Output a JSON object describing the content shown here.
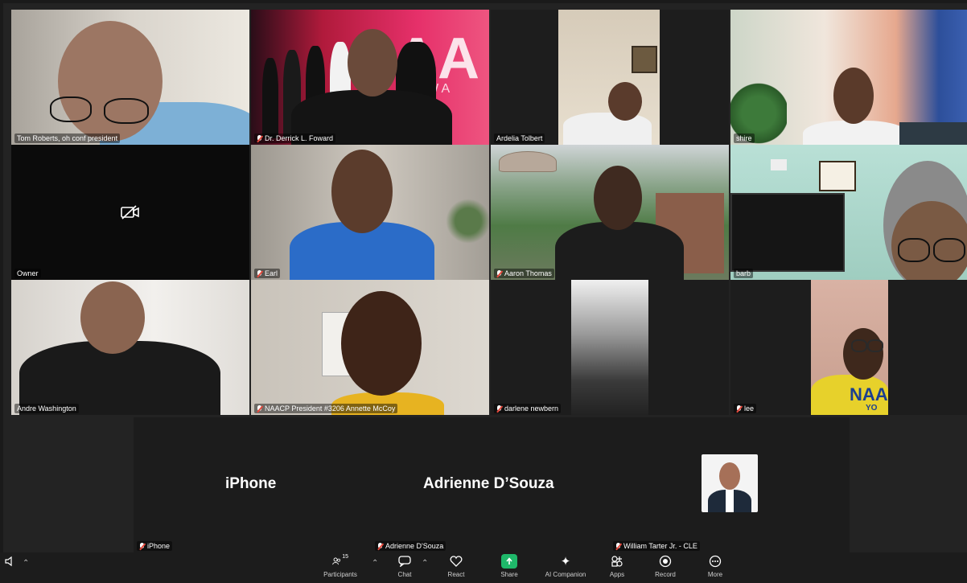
{
  "meeting": {
    "tiles": [
      {
        "id": "t1",
        "name": "Tom Roberts, oh conf president",
        "muted": false
      },
      {
        "id": "t2",
        "name": "Dr. Derrick L. Foward",
        "muted": true
      },
      {
        "id": "t3",
        "name": "Ardelia Tolbert",
        "muted": false
      },
      {
        "id": "t4",
        "name": "shire",
        "muted": false
      },
      {
        "id": "t5",
        "name": "Owner",
        "muted": false
      },
      {
        "id": "t6",
        "name": "Earl",
        "muted": true
      },
      {
        "id": "t7",
        "name": "Aaron Thomas",
        "muted": true
      },
      {
        "id": "t8",
        "name": "barb",
        "muted": false
      },
      {
        "id": "t9",
        "name": "Andre Washington",
        "muted": false
      },
      {
        "id": "t10",
        "name": "NAACP President #3206 Annette McCoy",
        "muted": true
      },
      {
        "id": "t11",
        "name": "darlene newbern",
        "muted": true
      },
      {
        "id": "t12",
        "name": "lee",
        "muted": true
      }
    ],
    "audio_tiles": [
      {
        "display": "iPhone",
        "name": "iPhone",
        "muted": true
      },
      {
        "display": "Adrienne D’Souza",
        "name": "Adrienne D'Souza",
        "muted": true
      },
      {
        "display": "",
        "name": "William Tarter Jr. - CLE",
        "muted": true
      }
    ],
    "banner_text": "AA",
    "banner_sub": "WA",
    "shirt_text": "NAA",
    "shirt_sub": "YO"
  },
  "toolbar": {
    "participants_count": "15",
    "buttons": [
      {
        "key": "participants",
        "label": "Participants",
        "icon": "participants-icon"
      },
      {
        "key": "chat",
        "label": "Chat",
        "icon": "chat-icon"
      },
      {
        "key": "react",
        "label": "React",
        "icon": "heart-icon"
      },
      {
        "key": "share",
        "label": "Share",
        "icon": "share-icon"
      },
      {
        "key": "ai",
        "label": "AI Companion",
        "icon": "sparkle-icon"
      },
      {
        "key": "apps",
        "label": "Apps",
        "icon": "apps-icon"
      },
      {
        "key": "record",
        "label": "Record",
        "icon": "record-icon"
      },
      {
        "key": "more",
        "label": "More",
        "icon": "more-icon"
      }
    ]
  },
  "colors": {
    "active_speaker": "#2fd06a",
    "share_green": "#1fb86a",
    "mute_red": "#e5483c"
  }
}
